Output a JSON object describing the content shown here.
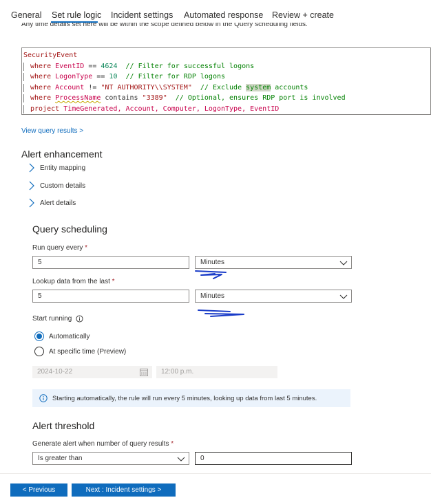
{
  "tabs": [
    {
      "label": "General"
    },
    {
      "label": "Set rule logic"
    },
    {
      "label": "Incident settings"
    },
    {
      "label": "Automated response"
    },
    {
      "label": "Review + create"
    }
  ],
  "partial_text": "Any time details set here will be within the scope defined below in the Query scheduling fields.",
  "query": {
    "table": "SecurityEvent",
    "lines": [
      {
        "kw": "where",
        "field": "EventID",
        "op": " == ",
        "val": "4624",
        "cmt": "  // Filter for successful logons"
      },
      {
        "kw": "where",
        "field": "LogonType",
        "op": " == ",
        "val": "10",
        "cmt": "  // Filter for RDP logons"
      },
      {
        "kw": "where",
        "field": "Account",
        "op": " != ",
        "val": "\"NT AUTHORITY\\\\SYSTEM\"",
        "cmt_a": "  // Exclude ",
        "cmt_hl": "system",
        "cmt_b": " accounts"
      },
      {
        "kw": "where",
        "field": "ProcessName",
        "op": " contains ",
        "val": "\"3389\"",
        "cmt": "  // Optional, ensures RDP port is involved"
      },
      {
        "kw": "project",
        "fields": "TimeGenerated, Account, Computer, LogonType, EventID"
      }
    ]
  },
  "view_results_link": "View query results >",
  "alert_enhancement": {
    "title": "Alert enhancement",
    "items": [
      "Entity mapping",
      "Custom details",
      "Alert details"
    ]
  },
  "query_scheduling": {
    "title": "Query scheduling",
    "run_every_label": "Run query every",
    "run_every_value": "5",
    "run_every_unit": "Minutes",
    "lookup_label": "Lookup data from the last",
    "lookup_value": "5",
    "lookup_unit": "Minutes",
    "start_running_label": "Start running",
    "options": [
      "Automatically",
      "At specific time (Preview)"
    ],
    "selected_option": "Automatically",
    "date_value": "2024-10-22",
    "time_value": "12:00 p.m.",
    "info_text": "Starting automatically, the rule will run every 5 minutes, looking up data from last 5 minutes."
  },
  "alert_threshold": {
    "title": "Alert threshold",
    "label": "Generate alert when number of query results",
    "operator": "Is greater than",
    "value": "0"
  },
  "buttons": {
    "previous": "< Previous",
    "next": "Next : Incident settings >"
  },
  "colors": {
    "accent": "#0f6cbd",
    "annotation_ink": "#1a3cc8"
  }
}
